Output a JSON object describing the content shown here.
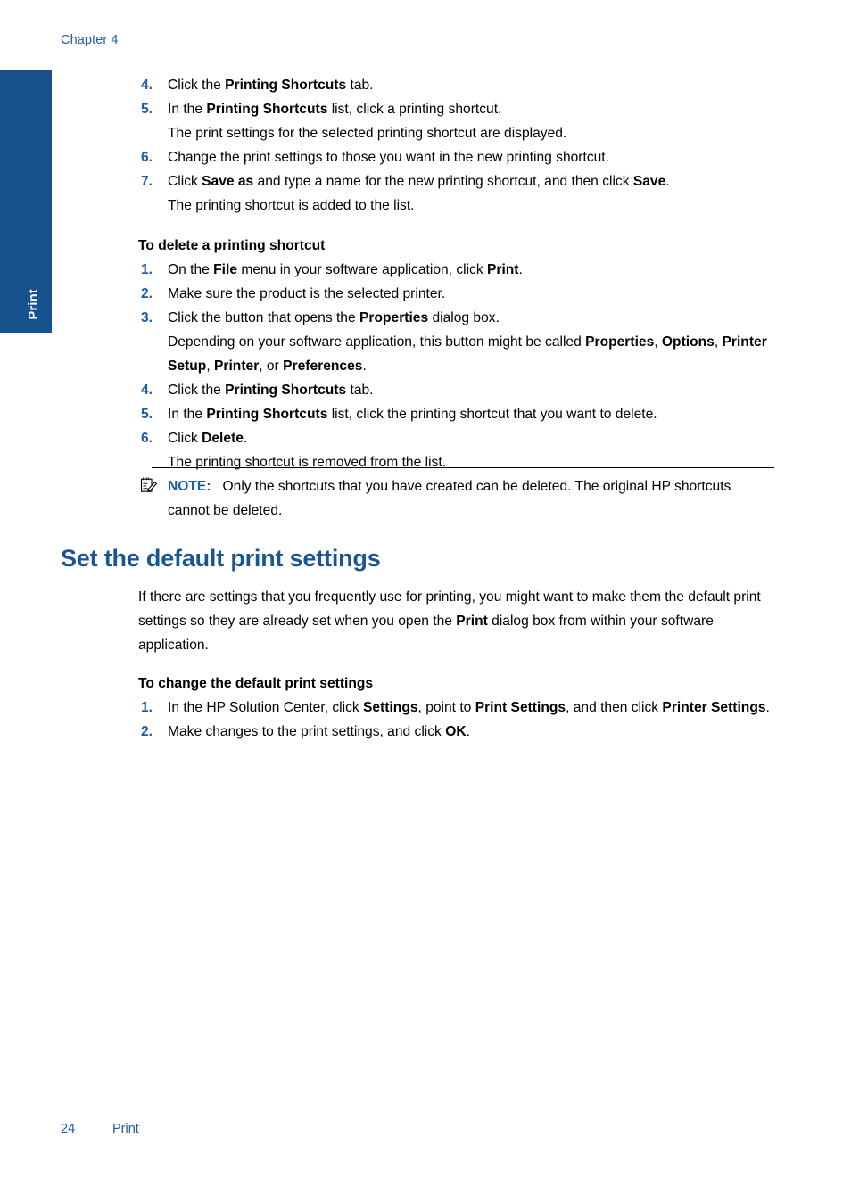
{
  "page": {
    "chapter_header": "Chapter 4",
    "side_tab_label": "Print",
    "colors": {
      "tab_blue": "#17528f",
      "heading_blue": "#1a5596",
      "accent_blue": "#1f5ca8",
      "body_black": "#000000"
    }
  },
  "create_shortcut_steps": {
    "s4": {
      "num": "4.",
      "pre": "Click the ",
      "bold": "Printing Shortcuts",
      "post": " tab."
    },
    "s5": {
      "num": "5.",
      "pre": "In the ",
      "bold": "Printing Shortcuts",
      "post": " list, click a printing shortcut.",
      "sub": "The print settings for the selected printing shortcut are displayed."
    },
    "s6": {
      "num": "6.",
      "text": "Change the print settings to those you want in the new printing shortcut."
    },
    "s7": {
      "num": "7.",
      "pre": "Click ",
      "bold1": "Save as",
      "mid": " and type a name for the new printing shortcut, and then click ",
      "bold2": "Save",
      "post": ".",
      "sub": "The printing shortcut is added to the list."
    }
  },
  "delete_section": {
    "heading": "To delete a printing shortcut",
    "s1": {
      "num": "1.",
      "pre": "On the ",
      "bold1": "File",
      "mid": " menu in your software application, click ",
      "bold2": "Print",
      "post": "."
    },
    "s2": {
      "num": "2.",
      "text": "Make sure the product is the selected printer."
    },
    "s3": {
      "num": "3.",
      "pre": "Click the button that opens the ",
      "bold": "Properties",
      "post": " dialog box.",
      "sub_a": "Depending on your software application, this button might be called ",
      "sub_b1": "Properties",
      "sub_b2": ", ",
      "sub_b3": "Options",
      "sub_b4": ", ",
      "sub_b5": "Printer Setup",
      "sub_b6": ", ",
      "sub_b7": "Printer",
      "sub_b8": ", or ",
      "sub_b9": "Preferences",
      "sub_b10": "."
    },
    "s4": {
      "num": "4.",
      "pre": "Click the ",
      "bold": "Printing Shortcuts",
      "post": " tab."
    },
    "s5": {
      "num": "5.",
      "pre": "In the ",
      "bold": "Printing Shortcuts",
      "post": " list, click the printing shortcut that you want to delete."
    },
    "s6": {
      "num": "6.",
      "pre": "Click ",
      "bold": "Delete",
      "post": ".",
      "sub": "The printing shortcut is removed from the list."
    }
  },
  "note": {
    "icon": "note-pencil-icon",
    "label": "NOTE:",
    "text": "Only the shortcuts that you have created can be deleted. The original HP shortcuts cannot be deleted."
  },
  "default_settings_section": {
    "heading": "Set the default print settings",
    "intro_a": "If there are settings that you frequently use for printing, you might want to make them the default print settings so they are already set when you open the ",
    "intro_bold": "Print",
    "intro_b": " dialog box from within your software application.",
    "sub_heading": "To change the default print settings",
    "s1": {
      "num": "1.",
      "pre": "In the HP Solution Center, click ",
      "bold1": "Settings",
      "mid": ", point to ",
      "bold2": "Print Settings",
      "post": ", and then click ",
      "bold3": "Printer Settings",
      "tail": "."
    },
    "s2": {
      "num": "2.",
      "pre": "Make changes to the print settings, and click ",
      "bold": "OK",
      "post": "."
    }
  },
  "footer": {
    "page_number": "24",
    "section": "Print"
  }
}
